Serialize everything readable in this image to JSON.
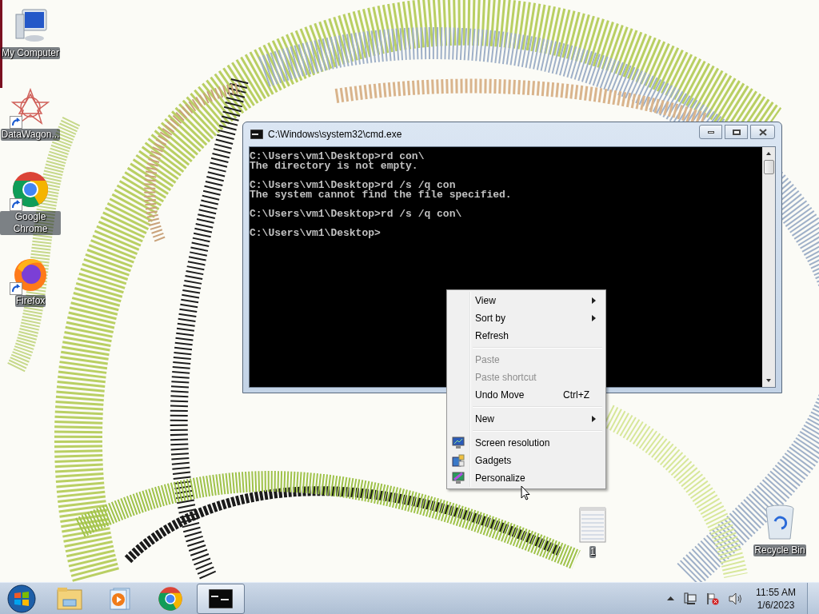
{
  "desktop_icons": [
    {
      "label": "My Computer",
      "kind": "computer",
      "shortcut": false
    },
    {
      "label": "DataWagon...",
      "kind": "star",
      "shortcut": true
    },
    {
      "label": "Google Chrome",
      "kind": "chrome",
      "shortcut": true
    },
    {
      "label": "Firefox",
      "kind": "firefox",
      "shortcut": true
    },
    {
      "label": "1",
      "kind": "file",
      "shortcut": false
    },
    {
      "label": "Recycle Bin",
      "kind": "recycle",
      "shortcut": false
    }
  ],
  "window": {
    "title": "C:\\Windows\\system32\\cmd.exe",
    "console_blocks": [
      [
        "C:\\Users\\vm1\\Desktop>rd con\\",
        "The directory is not empty."
      ],
      [
        "C:\\Users\\vm1\\Desktop>rd /s /q con",
        "The system cannot find the file specified."
      ],
      [
        "C:\\Users\\vm1\\Desktop>rd /s /q con\\"
      ],
      [
        "C:\\Users\\vm1\\Desktop>"
      ]
    ]
  },
  "context_menu": [
    {
      "kind": "item",
      "label": "View",
      "disabled": false,
      "submenu": true
    },
    {
      "kind": "item",
      "label": "Sort by",
      "disabled": false,
      "submenu": true
    },
    {
      "kind": "item",
      "label": "Refresh",
      "disabled": false,
      "submenu": false
    },
    {
      "kind": "separator"
    },
    {
      "kind": "item",
      "label": "Paste",
      "disabled": true,
      "submenu": false
    },
    {
      "kind": "item",
      "label": "Paste shortcut",
      "disabled": true,
      "submenu": false
    },
    {
      "kind": "item",
      "label": "Undo Move",
      "disabled": false,
      "submenu": false,
      "shortcut": "Ctrl+Z"
    },
    {
      "kind": "separator"
    },
    {
      "kind": "item",
      "label": "New",
      "disabled": false,
      "submenu": true
    },
    {
      "kind": "separator"
    },
    {
      "kind": "icon_item",
      "label": "Screen resolution",
      "disabled": false,
      "submenu": false
    },
    {
      "kind": "icon_item",
      "label": "Gadgets",
      "disabled": false,
      "submenu": false
    },
    {
      "kind": "icon_item",
      "label": "Personalize",
      "disabled": false,
      "submenu": false
    }
  ],
  "taskbar": {
    "apps": [
      {
        "kind": "explorer",
        "active": false
      },
      {
        "kind": "media",
        "active": false
      },
      {
        "kind": "chrome",
        "active": false
      },
      {
        "kind": "cmd",
        "active": true
      }
    ],
    "clock": {
      "time": "11:55 AM",
      "date": "1/6/2023"
    }
  }
}
